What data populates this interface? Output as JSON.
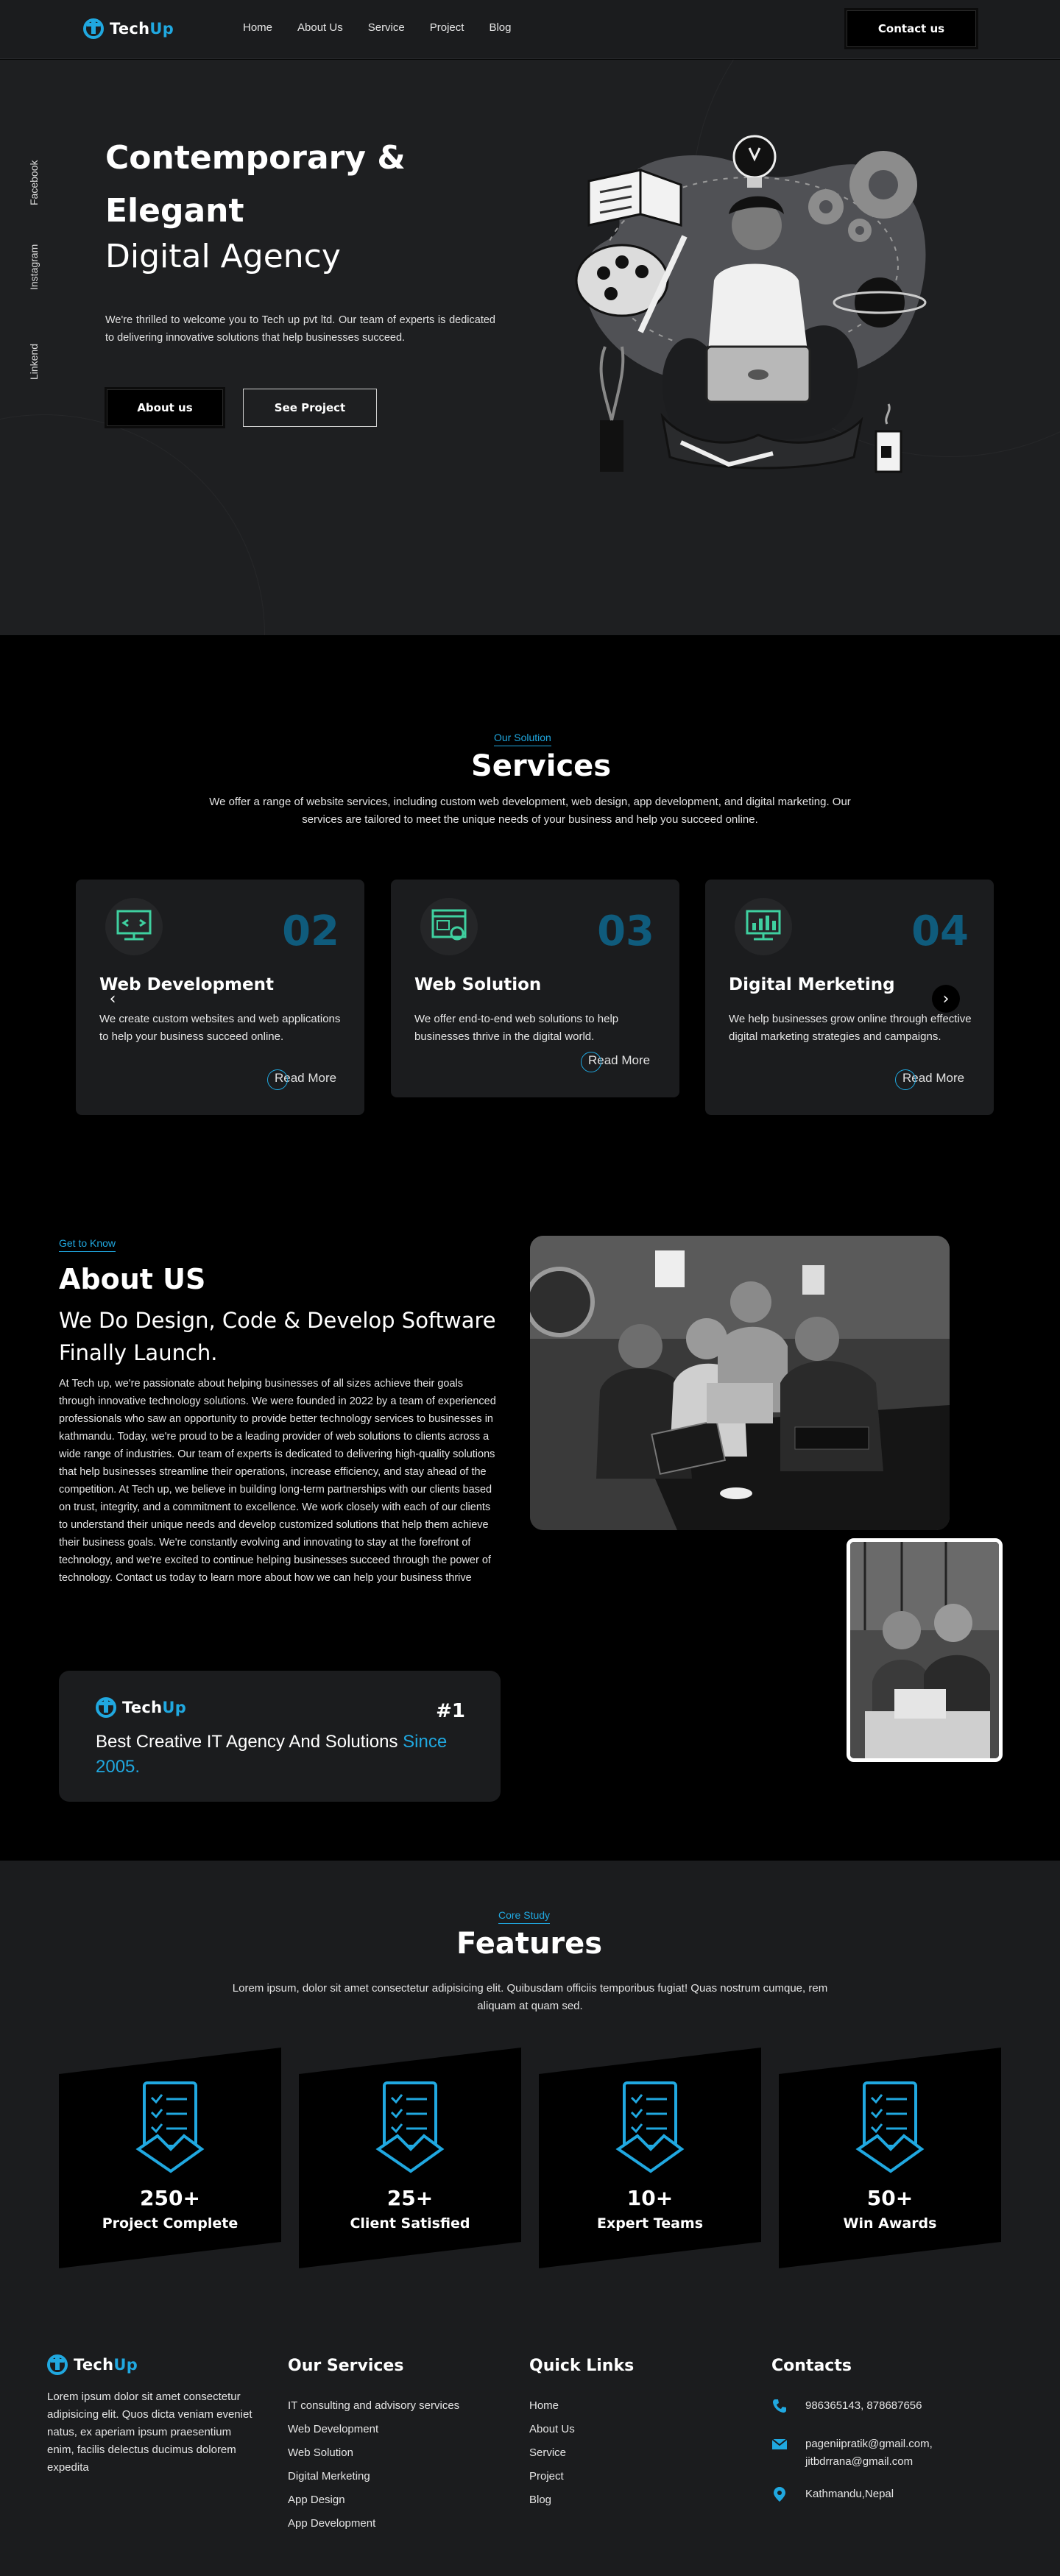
{
  "brand": {
    "name_a": "Tech",
    "name_b": "Up",
    "accent": "#20a8e0"
  },
  "nav": {
    "links": [
      "Home",
      "About Us",
      "Service",
      "Project",
      "Blog"
    ],
    "contact_label": "Contact us"
  },
  "social": [
    "Facebook",
    "Instagram",
    "Linkend"
  ],
  "hero": {
    "title_line1": "Contemporary &",
    "title_line2": "Elegant",
    "subtitle": "Digital Agency",
    "text": "We're thrilled to welcome you to Tech up pvt ltd. Our team of experts is dedicated to delivering innovative solutions that help businesses succeed.",
    "about_label": "About us",
    "project_label": "See Project"
  },
  "services": {
    "eyebrow": "Our Solution",
    "title": "Services",
    "description": "We offer a range of website services, including custom web development, web design, app development, and digital marketing. Our services are tailored to meet the unique needs of your business and help you succeed online.",
    "cards": [
      {
        "num": "02",
        "title": "Web Development",
        "text": "We create custom websites and web applications to help your business succeed online.",
        "more": "Read More",
        "icon": "web-development-icon"
      },
      {
        "num": "03",
        "title": "Web Solution",
        "text": "We offer end-to-end web solutions to help businesses thrive in the digital world.",
        "more": "Read More",
        "icon": "web-solution-icon"
      },
      {
        "num": "04",
        "title": "Digital Merketing",
        "text": "We help businesses grow online through effective digital marketing strategies and campaigns.",
        "more": "Read More",
        "icon": "digital-marketing-icon"
      }
    ],
    "prev": "‹",
    "next": "›"
  },
  "about": {
    "eyebrow": "Get to Know",
    "title": "About US",
    "subtitle": "We Do Design, Code & Develop Software Finally Launch.",
    "text": "At Tech up, we're passionate about helping businesses of all sizes achieve their goals through innovative technology solutions. We were founded in 2022 by a team of experienced professionals who saw an opportunity to provide better technology services to businesses in kathmandu. Today, we're proud to be a leading provider of web solutions to clients across a wide range of industries. Our team of experts is dedicated to delivering high-quality solutions that help businesses streamline their operations, increase efficiency, and stay ahead of the competition. At Tech up, we believe in building long-term partnerships with our clients based on trust, integrity, and a commitment to excellence. We work closely with each of our clients to understand their unique needs and develop customized solutions that help them achieve their business goals. We're constantly evolving and innovating to stay at the forefront of technology, and we're excited to continue helping businesses succeed through the power of technology. Contact us today to learn more about how we can help your business thrive",
    "badge_rank": "#1",
    "badge_text": "Best Creative IT Agency And Solutions ",
    "badge_highlight": "Since 2005."
  },
  "features": {
    "eyebrow": "Core Study",
    "title": "Features",
    "description": "Lorem ipsum, dolor sit amet consectetur adipisicing elit. Quibusdam officiis temporibus fugiat! Quas nostrum cumque, rem aliquam at quam sed.",
    "items": [
      {
        "value": "250+",
        "label": "Project Complete"
      },
      {
        "value": "25+",
        "label": "Client Satisfied"
      },
      {
        "value": "10+",
        "label": "Expert Teams"
      },
      {
        "value": "50+",
        "label": "Win Awards"
      }
    ]
  },
  "footer": {
    "about_text": "Lorem ipsum dolor sit amet consectetur adipisicing elit. Quos dicta veniam eveniet natus, ex aperiam ipsum praesentium enim, facilis delectus ducimus dolorem expedita",
    "services_title": "Our Services",
    "services": [
      "IT consulting and advisory services",
      "Web Development",
      "Web Solution",
      "Digital Merketing",
      "App Design",
      "App Development"
    ],
    "links_title": "Quick Links",
    "links": [
      "Home",
      "About Us",
      "Service",
      "Project",
      "Blog"
    ],
    "contacts_title": "Contacts",
    "phone": "986365143, 878687656",
    "email": "pageniipratik@gmail.com, jitbdrrana@gmail.com",
    "location": "Kathmandu,Nepal"
  }
}
